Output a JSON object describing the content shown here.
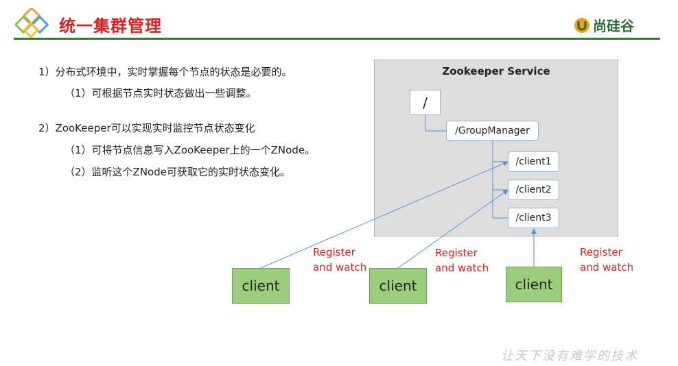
{
  "header": {
    "title": "统一集群管理",
    "brand_text": "尚硅谷",
    "accent_color": "#e01e1e",
    "rule_color": "#2e7d32",
    "logo_icon": "diamond-logo-icon",
    "brand_icon": "u-shield-icon"
  },
  "content": {
    "bullets": [
      {
        "text": "1）分布式环境中，实时掌握每个节点的状态是必要的。",
        "subs": [
          "（1）可根据节点实时状态做出一些调整。"
        ]
      },
      {
        "text": "2）ZooKeeper可以实现实时监控节点状态变化",
        "subs": [
          "（1）可将节点信息写入ZooKeeper上的一个ZNode。",
          "（2）监听这个ZNode可获取它的实时状态变化。"
        ]
      }
    ]
  },
  "diagram": {
    "service_title": "Zookeeper Service",
    "znodes": [
      "/",
      "/GroupManager",
      "/client1",
      "/client2",
      "/client3"
    ],
    "clients": [
      "client",
      "client",
      "client"
    ],
    "edge_labels": [
      [
        "Register",
        "and watch"
      ],
      [
        "Register",
        "and watch"
      ],
      [
        "Register",
        "and watch"
      ]
    ],
    "client_color": "#9bcd7d",
    "edge_color": "#5b8fd0",
    "edge_label_color": "#e01e1e"
  },
  "footer": {
    "slogan": "让天下没有难学的技术"
  }
}
